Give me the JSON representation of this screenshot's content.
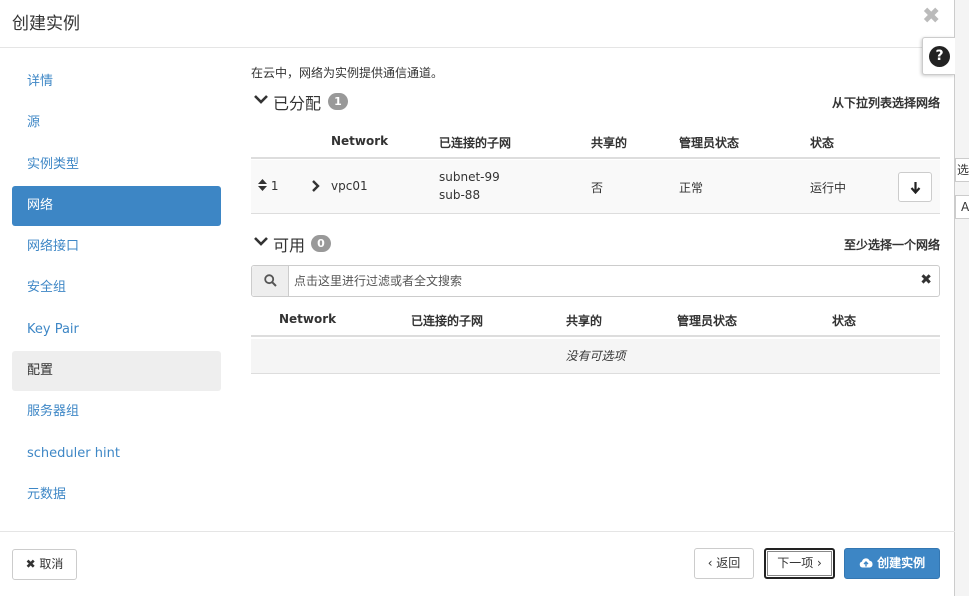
{
  "modal": {
    "title": "创建实例",
    "close_symbol": "✖",
    "help_symbol": "?"
  },
  "edge": {
    "text1": "选",
    "text2": "A"
  },
  "sidebar": {
    "items": [
      {
        "label": "详情",
        "state": "normal"
      },
      {
        "label": "源",
        "state": "normal"
      },
      {
        "label": "实例类型",
        "state": "normal"
      },
      {
        "label": "网络",
        "state": "active"
      },
      {
        "label": "网络接口",
        "state": "normal"
      },
      {
        "label": "安全组",
        "state": "normal"
      },
      {
        "label": "Key Pair",
        "state": "normal"
      },
      {
        "label": "配置",
        "state": "gray"
      },
      {
        "label": "服务器组",
        "state": "normal"
      },
      {
        "label": "scheduler hint",
        "state": "normal"
      },
      {
        "label": "元数据",
        "state": "normal"
      }
    ]
  },
  "main": {
    "intro": "在云中，网络为实例提供通信通道。",
    "allocated": {
      "title": "已分配",
      "count": "1",
      "hint": "从下拉列表选择网络",
      "columns": [
        "Network",
        "已连接的子网",
        "共享的",
        "管理员状态",
        "状态"
      ],
      "rows": [
        {
          "order": "1",
          "network": "vpc01",
          "subnets": [
            "subnet-99",
            "sub-88"
          ],
          "shared": "否",
          "admin_state": "正常",
          "status": "运行中"
        }
      ]
    },
    "available": {
      "title": "可用",
      "count": "0",
      "hint": "至少选择一个网络",
      "search_placeholder": "点击这里进行过滤或者全文搜索",
      "clear_symbol": "✖",
      "columns": [
        "Network",
        "已连接的子网",
        "共享的",
        "管理员状态",
        "状态"
      ],
      "empty_text": "没有可选项"
    }
  },
  "footer": {
    "cancel": "✖ 取消",
    "back": "‹ 返回",
    "next": "下一项 ›",
    "create": "创建实例"
  },
  "colors": {
    "accent": "#3d86c5",
    "link": "#3e87c6",
    "badge": "#999999"
  }
}
